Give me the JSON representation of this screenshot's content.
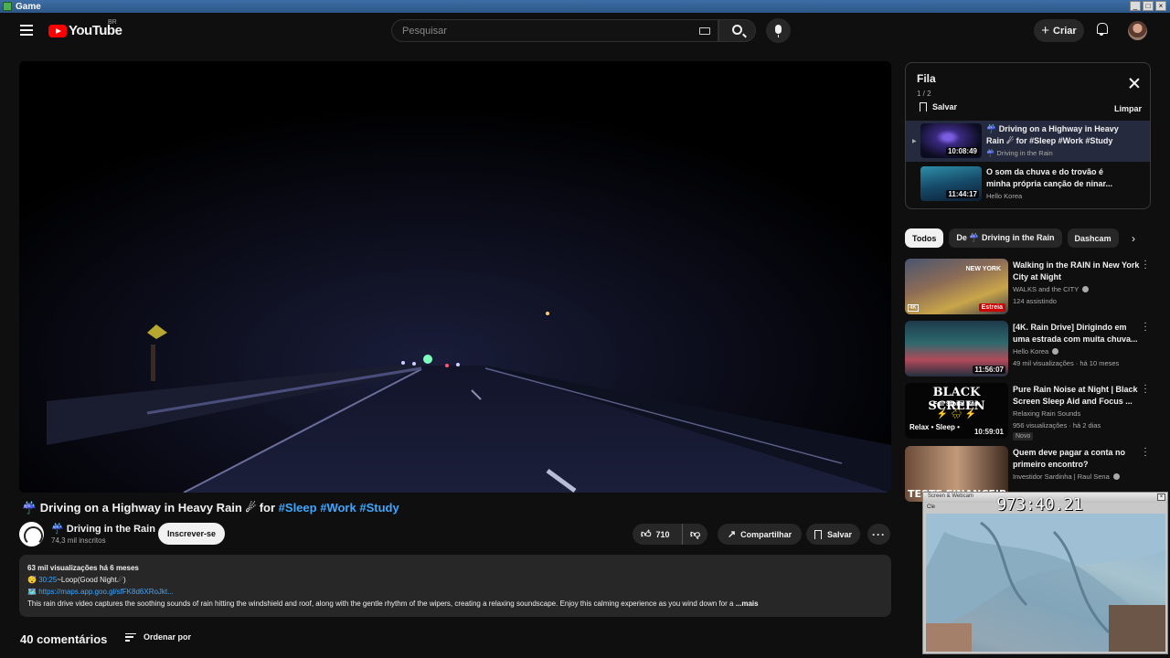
{
  "window": {
    "title": "Game",
    "controls": [
      "_",
      "□",
      "×"
    ]
  },
  "header": {
    "logo_text": "YouTube",
    "region": "BR",
    "search_placeholder": "Pesquisar",
    "create_label": "Criar"
  },
  "video": {
    "title_prefix": "☔ Driving on a Highway in Heavy Rain ☄ for ",
    "tags": [
      "#Sleep",
      "#Work",
      "#Study"
    ],
    "channel_name": "☔ Driving in the Rain",
    "subscribers": "74,3 mil inscritos",
    "subscribe_label": "Inscrever-se",
    "likes": "710",
    "share_label": "Compartilhar",
    "save_label": "Salvar",
    "more_label": "···"
  },
  "description": {
    "stats": "63 mil visualizações  há 6 meses",
    "line2_prefix": "😴 ",
    "line2_link": "30:25",
    "line2_suffix": "~Loop(Good Night☄)",
    "line3_prefix": "🗺️ ",
    "line3_link": "https://maps.app.goo.gl/sfFK8d6XRoJkt...",
    "line4": "This rain drive video captures the soothing sounds of rain hitting the windshield and roof, along with the gentle rhythm of the wipers, creating a relaxing soundscape. Enjoy this calming experience as you wind down for a",
    "more_label": "...mais"
  },
  "comments": {
    "count_label": "40 comentários",
    "sort_label": "Ordenar por"
  },
  "queue": {
    "title": "Fila",
    "position": "1 / 2",
    "save_label": "Salvar",
    "clear_label": "Limpar",
    "items": [
      {
        "title": "☔ Driving on a Highway in Heavy Rain ☄ for #Sleep #Work #Study",
        "channel": "☔ Driving in the Rain",
        "duration": "10:08:49"
      },
      {
        "title": "O som da chuva e do trovão é minha própria canção de ninar...",
        "channel": "Hello Korea",
        "duration": "11:44:17"
      }
    ]
  },
  "chips": [
    "Todos",
    "De ☔ Driving in the Rain",
    "Dashcam"
  ],
  "recommendations": [
    {
      "title": "Walking in the RAIN in New York City at Night",
      "channel": "WALKS and the CITY",
      "stats": "124 assistindo",
      "badge": "",
      "duration": "",
      "premiere": "Estreia",
      "thumb_text": "NEW YORK",
      "quality": "4K"
    },
    {
      "title": "[4K. Rain Drive] Dirigindo em uma estrada com muita chuva...",
      "channel": "Hello Korea",
      "stats": "49 mil visualizações · há 10 meses",
      "badge": "",
      "duration": "11:56:07"
    },
    {
      "title": "Pure Rain Noise at Night | Black Screen Sleep Aid and Focus ...",
      "channel": "Relaxing Rain Sounds",
      "stats": "956 visualizações · há 2 dias",
      "badge": "Novo",
      "duration": "10:59:01",
      "thumb_title": "BLACK SCREEN",
      "thumb_sub": "Fall Storm Rain",
      "thumb_bottom": "Relax • Sleep •"
    },
    {
      "title": "Quem deve pagar a conta no primeiro encontro?",
      "channel": "Investidor Sardinha | Raul Sena",
      "stats": "",
      "badge": "",
      "duration": "",
      "thumb_text": "TESTE FINANCEIRO"
    }
  ],
  "webcam": {
    "title": "Screen & Webcam",
    "timer": "973:40.21",
    "close": "×",
    "small": "Cle"
  },
  "colors": {
    "background": "#0f0f0f",
    "accent_link": "#3ea6ff",
    "brand_red": "#ff0000",
    "queue_active": "#262a3e"
  }
}
